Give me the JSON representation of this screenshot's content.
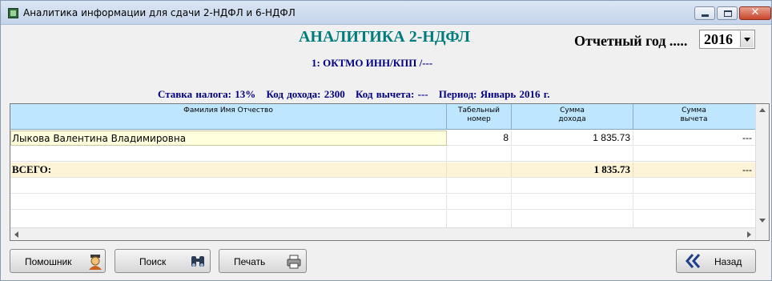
{
  "window": {
    "title": "Аналитика информации для сдачи 2-НДФЛ и 6-НДФЛ",
    "minimize_label": "minimize",
    "maximize_label": "maximize",
    "close_glyph": "✕"
  },
  "header": {
    "title": "АНАЛИТИКА 2-НДФЛ",
    "year_label": "Отчетный год .....",
    "year_value": "2016",
    "subtitle": "1: ОКТМО  ИНН/КПП /---",
    "info": {
      "rate": "Ставка налога: 13%",
      "income_code": "Код дохода: 2300",
      "deduction_code": "Код вычета: ---",
      "period": "Период: Январь 2016 г."
    }
  },
  "table": {
    "columns": [
      {
        "label": "Фамилия Имя Отчество"
      },
      {
        "label": "Табельный\nномер"
      },
      {
        "label": "Сумма\nдохода"
      },
      {
        "label": "Сумма\nвычета"
      }
    ],
    "rows": [
      {
        "name": "Лыкова Валентина Владимировна",
        "tab_no": "8",
        "income": "1 835.73",
        "deduction": "---"
      }
    ],
    "total": {
      "label": "ВСЕГО:",
      "income": "1 835.73",
      "deduction": "---"
    }
  },
  "buttons": {
    "helper": "Помошник",
    "search": "Поиск",
    "print": "Печать",
    "back": "Назад"
  },
  "colors": {
    "title": "#007c7c",
    "info_text": "#000080",
    "header_bg": "#bfe6ff",
    "total_bg": "#fdf4d8",
    "selected_cell_bg": "#ffffdd"
  },
  "icons": [
    "app-icon",
    "helper-person-icon",
    "binoculars-icon",
    "printer-icon",
    "double-chevron-left-icon"
  ]
}
